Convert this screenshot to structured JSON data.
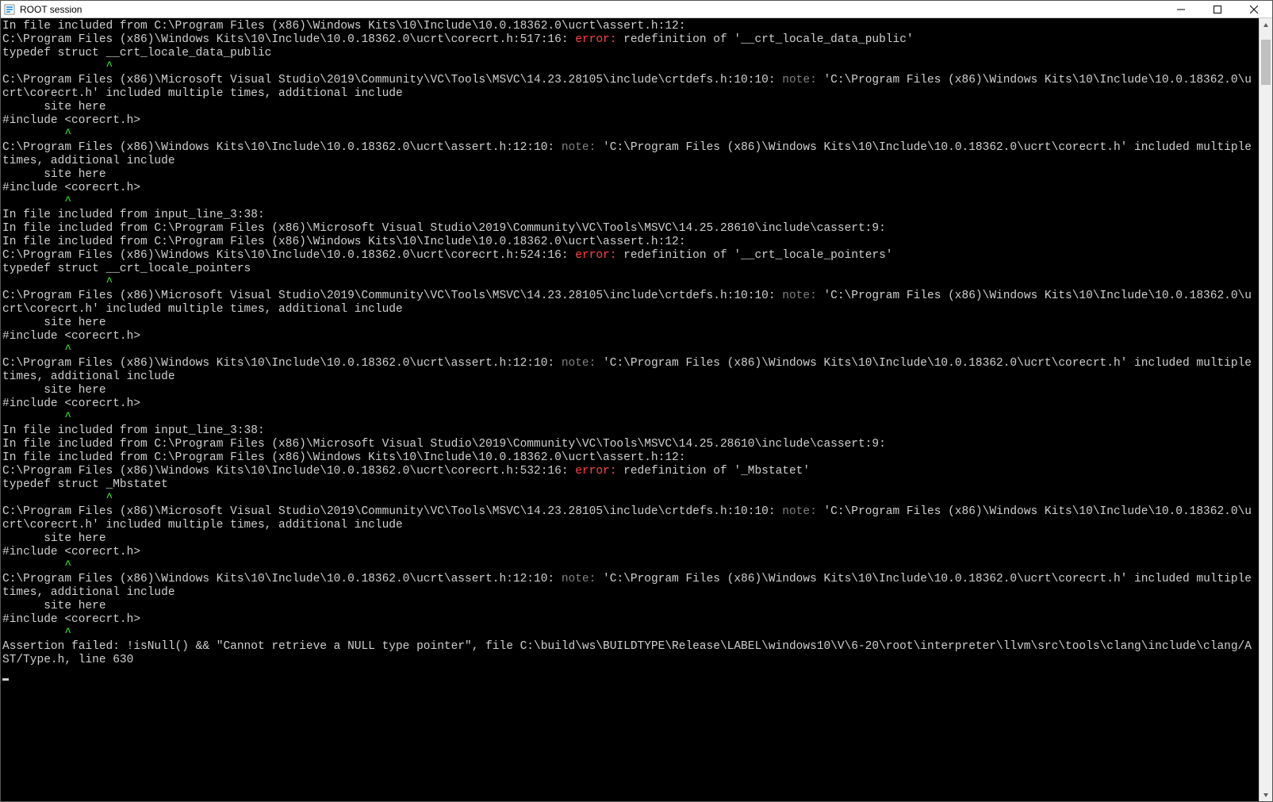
{
  "window": {
    "title": "ROOT session"
  },
  "scrollbar": {
    "thumb_top_pct": 1,
    "thumb_height_pct": 6
  },
  "colors": {
    "error": "#ff4444",
    "note": "#808080",
    "caret": "#33ff33",
    "fg": "#d0d0d0",
    "bg": "#000000"
  },
  "lines": [
    {
      "segs": [
        {
          "t": "In file included from C:\\Program Files (x86)\\Windows Kits\\10\\Include\\10.0.18362.0\\ucrt\\assert.h:12:"
        }
      ]
    },
    {
      "segs": [
        {
          "t": "C:\\Program Files (x86)\\Windows Kits\\10\\Include\\10.0.18362.0\\ucrt\\corecrt.h:517:16: "
        },
        {
          "t": "error:",
          "c": "err"
        },
        {
          "t": " redefinition of '__crt_locale_data_public'"
        }
      ]
    },
    {
      "segs": [
        {
          "t": "typedef struct __crt_locale_data_public"
        }
      ]
    },
    {
      "segs": [
        {
          "t": "               ^",
          "c": "caret"
        }
      ]
    },
    {
      "segs": [
        {
          "t": "C:\\Program Files (x86)\\Microsoft Visual Studio\\2019\\Community\\VC\\Tools\\MSVC\\14.23.28105\\include\\crtdefs.h:10:10: "
        },
        {
          "t": "note:",
          "c": "note"
        },
        {
          "t": " 'C:\\Program Files (x86)\\Windows Kits\\10\\Include\\10.0.18362.0\\ucrt\\corecrt.h' included multiple times, additional include"
        }
      ]
    },
    {
      "segs": [
        {
          "t": "      site here"
        }
      ]
    },
    {
      "segs": [
        {
          "t": "#include <corecrt.h>"
        }
      ]
    },
    {
      "segs": [
        {
          "t": "         ^",
          "c": "caret"
        }
      ]
    },
    {
      "segs": [
        {
          "t": "C:\\Program Files (x86)\\Windows Kits\\10\\Include\\10.0.18362.0\\ucrt\\assert.h:12:10: "
        },
        {
          "t": "note:",
          "c": "note"
        },
        {
          "t": " 'C:\\Program Files (x86)\\Windows Kits\\10\\Include\\10.0.18362.0\\ucrt\\corecrt.h' included multiple times, additional include"
        }
      ]
    },
    {
      "segs": [
        {
          "t": "      site here"
        }
      ]
    },
    {
      "segs": [
        {
          "t": "#include <corecrt.h>"
        }
      ]
    },
    {
      "segs": [
        {
          "t": "         ^",
          "c": "caret"
        }
      ]
    },
    {
      "segs": [
        {
          "t": "In file included from input_line_3:38:"
        }
      ]
    },
    {
      "segs": [
        {
          "t": "In file included from C:\\Program Files (x86)\\Microsoft Visual Studio\\2019\\Community\\VC\\Tools\\MSVC\\14.25.28610\\include\\cassert:9:"
        }
      ]
    },
    {
      "segs": [
        {
          "t": "In file included from C:\\Program Files (x86)\\Windows Kits\\10\\Include\\10.0.18362.0\\ucrt\\assert.h:12:"
        }
      ]
    },
    {
      "segs": [
        {
          "t": "C:\\Program Files (x86)\\Windows Kits\\10\\Include\\10.0.18362.0\\ucrt\\corecrt.h:524:16: "
        },
        {
          "t": "error:",
          "c": "err"
        },
        {
          "t": " redefinition of '__crt_locale_pointers'"
        }
      ]
    },
    {
      "segs": [
        {
          "t": "typedef struct __crt_locale_pointers"
        }
      ]
    },
    {
      "segs": [
        {
          "t": "               ^",
          "c": "caret"
        }
      ]
    },
    {
      "segs": [
        {
          "t": "C:\\Program Files (x86)\\Microsoft Visual Studio\\2019\\Community\\VC\\Tools\\MSVC\\14.23.28105\\include\\crtdefs.h:10:10: "
        },
        {
          "t": "note:",
          "c": "note"
        },
        {
          "t": " 'C:\\Program Files (x86)\\Windows Kits\\10\\Include\\10.0.18362.0\\ucrt\\corecrt.h' included multiple times, additional include"
        }
      ]
    },
    {
      "segs": [
        {
          "t": "      site here"
        }
      ]
    },
    {
      "segs": [
        {
          "t": "#include <corecrt.h>"
        }
      ]
    },
    {
      "segs": [
        {
          "t": "         ^",
          "c": "caret"
        }
      ]
    },
    {
      "segs": [
        {
          "t": "C:\\Program Files (x86)\\Windows Kits\\10\\Include\\10.0.18362.0\\ucrt\\assert.h:12:10: "
        },
        {
          "t": "note:",
          "c": "note"
        },
        {
          "t": " 'C:\\Program Files (x86)\\Windows Kits\\10\\Include\\10.0.18362.0\\ucrt\\corecrt.h' included multiple times, additional include"
        }
      ]
    },
    {
      "segs": [
        {
          "t": "      site here"
        }
      ]
    },
    {
      "segs": [
        {
          "t": "#include <corecrt.h>"
        }
      ]
    },
    {
      "segs": [
        {
          "t": "         ^",
          "c": "caret"
        }
      ]
    },
    {
      "segs": [
        {
          "t": "In file included from input_line_3:38:"
        }
      ]
    },
    {
      "segs": [
        {
          "t": "In file included from C:\\Program Files (x86)\\Microsoft Visual Studio\\2019\\Community\\VC\\Tools\\MSVC\\14.25.28610\\include\\cassert:9:"
        }
      ]
    },
    {
      "segs": [
        {
          "t": "In file included from C:\\Program Files (x86)\\Windows Kits\\10\\Include\\10.0.18362.0\\ucrt\\assert.h:12:"
        }
      ]
    },
    {
      "segs": [
        {
          "t": "C:\\Program Files (x86)\\Windows Kits\\10\\Include\\10.0.18362.0\\ucrt\\corecrt.h:532:16: "
        },
        {
          "t": "error:",
          "c": "err"
        },
        {
          "t": " redefinition of '_Mbstatet'"
        }
      ]
    },
    {
      "segs": [
        {
          "t": "typedef struct _Mbstatet"
        }
      ]
    },
    {
      "segs": [
        {
          "t": "               ^",
          "c": "caret"
        }
      ]
    },
    {
      "segs": [
        {
          "t": "C:\\Program Files (x86)\\Microsoft Visual Studio\\2019\\Community\\VC\\Tools\\MSVC\\14.23.28105\\include\\crtdefs.h:10:10: "
        },
        {
          "t": "note:",
          "c": "note"
        },
        {
          "t": " 'C:\\Program Files (x86)\\Windows Kits\\10\\Include\\10.0.18362.0\\ucrt\\corecrt.h' included multiple times, additional include"
        }
      ]
    },
    {
      "segs": [
        {
          "t": "      site here"
        }
      ]
    },
    {
      "segs": [
        {
          "t": "#include <corecrt.h>"
        }
      ]
    },
    {
      "segs": [
        {
          "t": "         ^",
          "c": "caret"
        }
      ]
    },
    {
      "segs": [
        {
          "t": "C:\\Program Files (x86)\\Windows Kits\\10\\Include\\10.0.18362.0\\ucrt\\assert.h:12:10: "
        },
        {
          "t": "note:",
          "c": "note"
        },
        {
          "t": " 'C:\\Program Files (x86)\\Windows Kits\\10\\Include\\10.0.18362.0\\ucrt\\corecrt.h' included multiple times, additional include"
        }
      ]
    },
    {
      "segs": [
        {
          "t": "      site here"
        }
      ]
    },
    {
      "segs": [
        {
          "t": "#include <corecrt.h>"
        }
      ]
    },
    {
      "segs": [
        {
          "t": "         ^",
          "c": "caret"
        }
      ]
    },
    {
      "segs": [
        {
          "t": "Assertion failed: !isNull() && \"Cannot retrieve a NULL type pointer\", file C:\\build\\ws\\BUILDTYPE\\Release\\LABEL\\windows10\\V\\6-20\\root\\interpreter\\llvm\\src\\tools\\clang\\include\\clang/AST/Type.h, line 630"
        }
      ]
    }
  ]
}
